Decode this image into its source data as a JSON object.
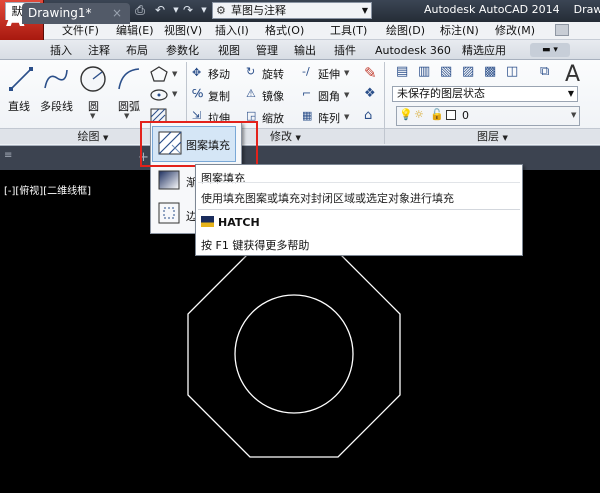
{
  "titlebar": {
    "workspace": "草图与注释",
    "app_title": "Autodesk AutoCAD 2014",
    "file_name": "Drawi"
  },
  "menus": [
    "文件(F)",
    "编辑(E)",
    "视图(V)",
    "插入(I)",
    "格式(O)",
    "工具(T)",
    "绘图(D)",
    "标注(N)",
    "修改(M)"
  ],
  "ribbon_tabs": [
    "默认",
    "插入",
    "注释",
    "布局",
    "参数化",
    "视图",
    "管理",
    "输出",
    "插件",
    "Autodesk 360",
    "精选应用"
  ],
  "draw_panel": {
    "buttons": [
      "直线",
      "多段线",
      "圆",
      "圆弧"
    ],
    "footer": "绘图"
  },
  "modify_panel": {
    "items": [
      "移动",
      "旋转",
      "延伸",
      "复制",
      "镜像",
      "圆角",
      "拉伸",
      "缩放",
      "阵列"
    ],
    "footer": "修改"
  },
  "layer_panel": {
    "state": "未保存的图层状态",
    "current_layer": "0",
    "footer": "图层"
  },
  "doc_tabs": {
    "active": "Drawing1*"
  },
  "viewport": {
    "label": "[-][俯视][二维线框]"
  },
  "flyout": {
    "items": [
      "图案填充",
      "渐",
      "边"
    ]
  },
  "tooltip": {
    "title": "图案填充",
    "description": "使用填充图案或填充对封闭区域或选定对象进行填充",
    "command": "HATCH",
    "help": "按 F1 键获得更多帮助"
  },
  "colors": {
    "highlight": "#e3221b",
    "drawing_lines": "#ffffff",
    "canvas": "#000000"
  }
}
